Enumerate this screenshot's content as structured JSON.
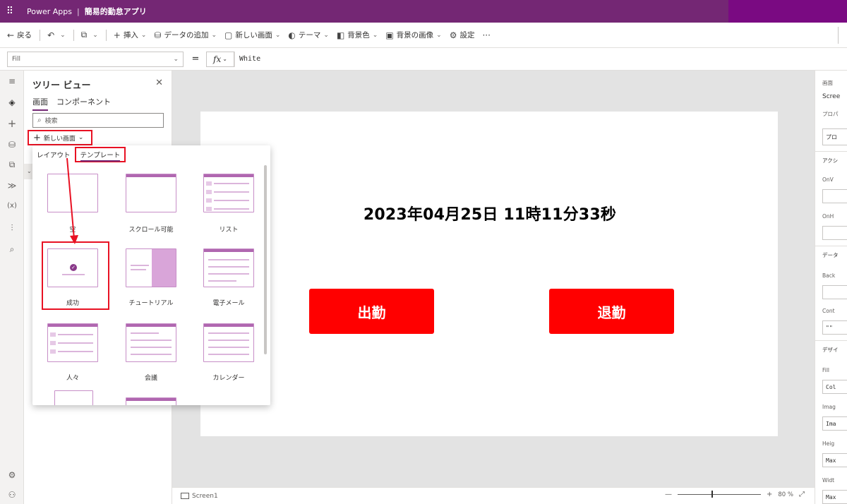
{
  "header": {
    "app_name": "Power Apps",
    "separator": "|",
    "app_title": "簡易的勤怠アプリ"
  },
  "commands": [
    {
      "icon": "←",
      "label": "戻る",
      "name": "back-button",
      "chev": false
    },
    {
      "icon": "↶",
      "label": "",
      "name": "undo-button",
      "chev": true
    },
    {
      "icon": "⧉",
      "label": "",
      "name": "paste-button",
      "chev": true
    },
    {
      "icon": "+",
      "label": "挿入",
      "name": "insert-button",
      "chev": true
    },
    {
      "icon": "⛁",
      "label": "データの追加",
      "name": "add-data-button",
      "chev": true
    },
    {
      "icon": "▢",
      "label": "新しい画面",
      "name": "new-screen-command",
      "chev": true
    },
    {
      "icon": "◐",
      "label": "テーマ",
      "name": "theme-button",
      "chev": true
    },
    {
      "icon": "◧",
      "label": "背景色",
      "name": "background-color-button",
      "chev": true
    },
    {
      "icon": "▣",
      "label": "背景の画像",
      "name": "background-image-button",
      "chev": true
    },
    {
      "icon": "⚙",
      "label": "設定",
      "name": "settings-button",
      "chev": false
    },
    {
      "icon": "···",
      "label": "",
      "name": "more-button",
      "chev": false
    }
  ],
  "formula_bar": {
    "property": "Fill",
    "equals": "=",
    "fx": "fx",
    "formula": "White"
  },
  "tree_view": {
    "title": "ツリー ビュー",
    "tabs": [
      "画面",
      "コンポーネント"
    ],
    "search_placeholder": "検索",
    "new_screen_label": "新しい画面"
  },
  "popup": {
    "tabs": {
      "layout": "レイアウト",
      "template": "テンプレート"
    },
    "tiles": [
      "空",
      "スクロール可能",
      "リスト",
      "成功",
      "チュートリアル",
      "電子メール",
      "人々",
      "会議",
      "カレンダー"
    ]
  },
  "canvas": {
    "clock_text": "2023年04月25日 11時11分33秒",
    "clock_in_label": "出勤",
    "clock_out_label": "退勤"
  },
  "status": {
    "screen_name": "Screen1",
    "zoom_minus": "—",
    "zoom_plus": "+",
    "zoom_percent": "80 %",
    "zoom_value": 80
  },
  "properties_pane": {
    "labels": [
      "画面",
      "Scree",
      "プロパ",
      "プロ",
      "アクシ",
      "OnV",
      "OnH",
      "データ",
      "Back",
      "Cont",
      "\"\"",
      "デザイ",
      "Fill",
      "Col",
      "Imag",
      "Ima",
      "Heig",
      "Max",
      "Widt",
      "Max"
    ]
  },
  "colors": {
    "brand": "#742774",
    "button_red": "#ff0000",
    "highlight_red": "#e81123"
  }
}
